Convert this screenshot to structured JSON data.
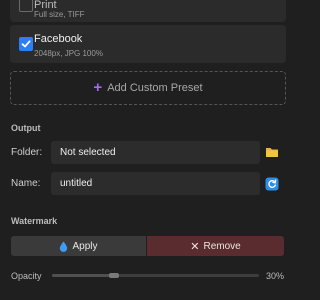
{
  "presets": [
    {
      "name": "Print",
      "description": "Full size, TIFF",
      "checked": false
    },
    {
      "name": "Facebook",
      "description": "2048px, JPG 100%",
      "checked": true
    }
  ],
  "add_preset_label": "Add Custom Preset",
  "output": {
    "section_title": "Output",
    "folder_label": "Folder:",
    "folder_value": "Not selected",
    "name_label": "Name:",
    "name_value": "untitled"
  },
  "watermark": {
    "section_title": "Watermark",
    "apply_label": "Apply",
    "remove_label": "Remove",
    "opacity_label": "Opacity",
    "opacity_value": "30%",
    "opacity_fraction": 0.3
  },
  "colors": {
    "accent_blue": "#2d7ff9",
    "accent_purple": "#a56bf0",
    "folder_yellow": "#e8b630",
    "remove_bg": "#5a2c2f"
  },
  "icons": {
    "folder": "folder-icon",
    "name_action": "refresh-icon",
    "apply": "droplet-icon",
    "remove": "close-icon",
    "add": "plus-icon"
  }
}
